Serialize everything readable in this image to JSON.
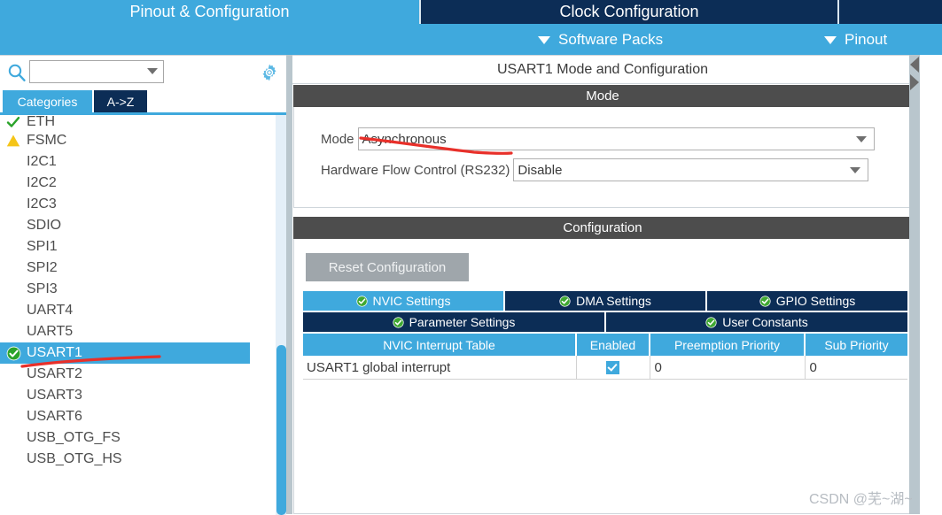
{
  "header": {
    "tabs": [
      {
        "label": "Pinout & Configuration",
        "active": false,
        "style": "light"
      },
      {
        "label": "Clock Configuration",
        "active": true,
        "style": "dark"
      },
      {
        "label": "",
        "active": true,
        "style": "dark"
      }
    ],
    "submenu": [
      {
        "label": "Software Packs",
        "icon": "chevron-down-icon"
      },
      {
        "label": "Pinout",
        "icon": "chevron-down-icon"
      }
    ]
  },
  "sidebar": {
    "search": {
      "value": "",
      "placeholder": "",
      "icon": "search-icon"
    },
    "settings_icon": "gear-icon",
    "category_tabs": [
      {
        "label": "Categories",
        "active": true
      },
      {
        "label": "A->Z",
        "active": false
      }
    ],
    "items": [
      {
        "label": "ETH",
        "status": "check",
        "selected": false,
        "clipped": true
      },
      {
        "label": "FSMC",
        "status": "warning",
        "selected": false
      },
      {
        "label": "I2C1",
        "status": "none",
        "selected": false
      },
      {
        "label": "I2C2",
        "status": "none",
        "selected": false
      },
      {
        "label": "I2C3",
        "status": "none",
        "selected": false
      },
      {
        "label": "SDIO",
        "status": "none",
        "selected": false
      },
      {
        "label": "SPI1",
        "status": "none",
        "selected": false
      },
      {
        "label": "SPI2",
        "status": "none",
        "selected": false
      },
      {
        "label": "SPI3",
        "status": "none",
        "selected": false
      },
      {
        "label": "UART4",
        "status": "none",
        "selected": false
      },
      {
        "label": "UART5",
        "status": "none",
        "selected": false
      },
      {
        "label": "USART1",
        "status": "check-badge",
        "selected": true
      },
      {
        "label": "USART2",
        "status": "none",
        "selected": false
      },
      {
        "label": "USART3",
        "status": "none",
        "selected": false
      },
      {
        "label": "USART6",
        "status": "none",
        "selected": false
      },
      {
        "label": "USB_OTG_FS",
        "status": "none",
        "selected": false
      },
      {
        "label": "USB_OTG_HS",
        "status": "none",
        "selected": false
      }
    ]
  },
  "main": {
    "panel_title": "USART1 Mode and Configuration",
    "mode_section": {
      "header": "Mode",
      "fields": [
        {
          "label": "Mode",
          "value": "Asynchronous"
        },
        {
          "label": "Hardware Flow Control (RS232)",
          "value": "Disable"
        }
      ]
    },
    "configuration_section": {
      "header": "Configuration",
      "reset_button": "Reset Configuration",
      "tabs_row1": [
        {
          "label": "NVIC Settings",
          "active": true,
          "icon": "check-badge-icon"
        },
        {
          "label": "DMA Settings",
          "active": false,
          "icon": "check-badge-icon"
        },
        {
          "label": "GPIO Settings",
          "active": false,
          "icon": "check-badge-icon"
        }
      ],
      "tabs_row2": [
        {
          "label": "Parameter Settings",
          "active": false,
          "icon": "check-badge-icon"
        },
        {
          "label": "User Constants",
          "active": false,
          "icon": "check-badge-icon"
        }
      ],
      "nvic_table": {
        "columns": [
          "NVIC Interrupt Table",
          "Enabled",
          "Preemption Priority",
          "Sub Priority"
        ],
        "rows": [
          {
            "name": "USART1 global interrupt",
            "enabled": true,
            "preemption_priority": "0",
            "sub_priority": "0"
          }
        ]
      }
    }
  },
  "watermark": "CSDN @芜~湖~",
  "colors": {
    "accent_blue": "#3fa9dd",
    "dark_navy": "#0c2d56",
    "section_gray": "#4d4d4d",
    "annotation_red": "#e8302a",
    "status_green": "#2aa32a",
    "status_yellow": "#f5c518"
  }
}
